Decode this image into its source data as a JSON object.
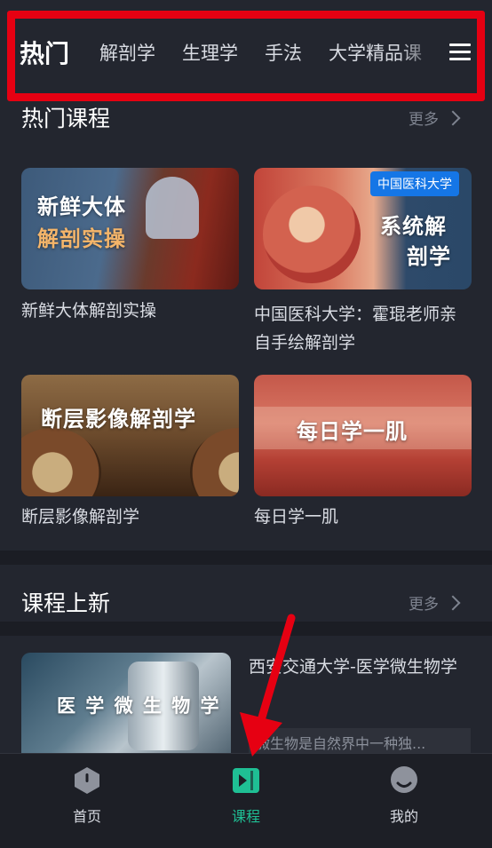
{
  "tabs": {
    "items": [
      "热门",
      "解剖学",
      "生理学",
      "手法",
      "大学精品课"
    ],
    "active_index": 0
  },
  "hot_courses": {
    "title": "热门课程",
    "more_label": "更多",
    "cards": [
      {
        "title": "新鲜大体解剖实操",
        "img_line1": "新鲜大体",
        "img_line2": "解剖实操"
      },
      {
        "title": "中国医科大学：霍琨老师亲自手绘解剖学",
        "badge": "中国医科大学",
        "img_line1": "系统解",
        "img_line2": "剖学"
      },
      {
        "title": "断层影像解剖学",
        "img_line1": "断层影像解剖学"
      },
      {
        "title": "每日学一肌",
        "img_line1": "每日学一肌"
      }
    ]
  },
  "new_courses": {
    "title": "课程上新",
    "more_label": "更多",
    "item": {
      "title": "西安交通大学-医学微生物学",
      "img_text": "医 学 微 生 物 学",
      "desc": "微生物是自然界中一种独..."
    }
  },
  "bottom_nav": {
    "items": [
      {
        "label": "首页",
        "icon": "home-icon"
      },
      {
        "label": "课程",
        "icon": "course-play-icon",
        "active": true
      },
      {
        "label": "我的",
        "icon": "profile-icon"
      }
    ]
  },
  "colors": {
    "background": "#23262f",
    "accent": "#1fbf94",
    "highlight_box": "#e60012",
    "badge": "#1576e6"
  }
}
